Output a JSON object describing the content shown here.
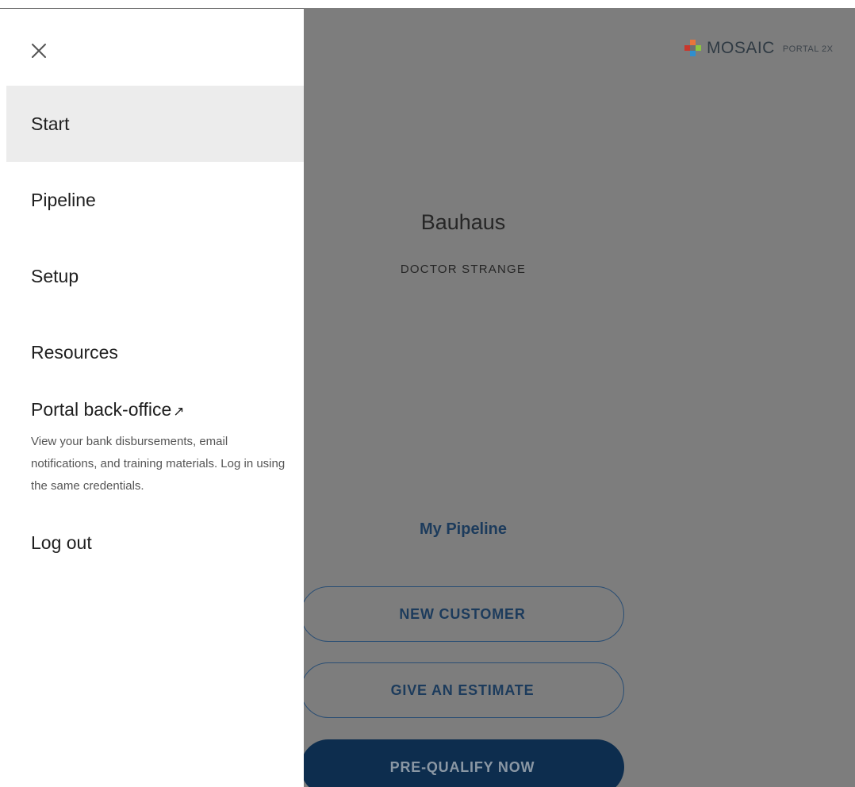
{
  "drawer": {
    "items": [
      {
        "label": "Start",
        "active": true
      },
      {
        "label": "Pipeline",
        "active": false
      },
      {
        "label": "Setup",
        "active": false
      },
      {
        "label": "Resources",
        "active": false
      }
    ],
    "back_office": {
      "label": "Portal back-office",
      "arrow": "↗",
      "description": "View your bank disbursements, email notifications, and training materials. Log in using the same credentials."
    },
    "logout_label": "Log out"
  },
  "header": {
    "brand": "MOSAIC",
    "brand_sub": "PORTAL 2X",
    "logo_colors": [
      "#e8743b",
      "#c9372c",
      "#8cc63f",
      "#2f8fce"
    ]
  },
  "main": {
    "company": "Bauhaus",
    "user": "DOCTOR STRANGE",
    "pipeline_link": "My Pipeline",
    "buttons": {
      "new_customer": "NEW CUSTOMER",
      "give_estimate": "GIVE AN ESTIMATE",
      "prequalify": "PRE-QUALIFY NOW"
    }
  },
  "colors": {
    "overlay": "#7d7d7d",
    "primary": "#0d2d4e",
    "drawer_active": "#ececec"
  }
}
